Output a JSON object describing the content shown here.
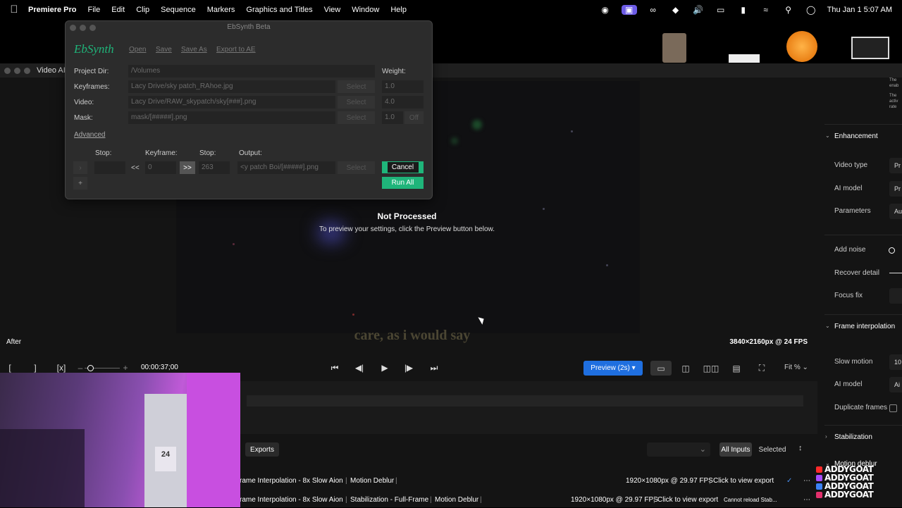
{
  "menubar": {
    "app": "Premiere Pro",
    "items": [
      "File",
      "Edit",
      "Clip",
      "Sequence",
      "Markers",
      "Graphics and Titles",
      "View",
      "Window",
      "Help"
    ],
    "clock": "Thu Jan 1  5:07 AM"
  },
  "video_window": {
    "title": "Video AI",
    "status_title": "Not Processed",
    "status_sub": "To preview your settings, click the Preview button below.",
    "caption": "care, as i would say",
    "after_label": "After",
    "resolution": "3840×2160px @ 24 FPS",
    "timecode": "00:00:37;00",
    "preview_button": "Preview (2s)",
    "fit_label": "Fit %"
  },
  "exports": {
    "tab": "Exports",
    "all_inputs": "All Inputs",
    "selected": "Selected",
    "rows": [
      {
        "name": "rame Interpolation - 8x Slow Aion",
        "tags": [
          "Motion Deblur"
        ],
        "spec": "1920×1080px @ 29.97 FPS",
        "link": "Click to view export",
        "extra": ""
      },
      {
        "name": "rame Interpolation - 8x Slow Aion",
        "tags": [
          "Stabilization - Full-Frame",
          "Motion Deblur"
        ],
        "spec": "1920×1080px @ 29.97 FPS",
        "link": "Click to view export",
        "extra": "Cannot reload Stab..."
      }
    ]
  },
  "right_panel": {
    "enhancement": "Enhancement",
    "video_type": "Video type",
    "video_type_val": "Pr",
    "ai_model": "AI model",
    "ai_model_val": "Pr",
    "parameters": "Parameters",
    "parameters_val": "Au",
    "add_noise": "Add noise",
    "recover_detail": "Recover detail",
    "focus_fix": "Focus fix",
    "frame_interp": "Frame interpolation",
    "slow_motion": "Slow motion",
    "slow_motion_val": "10",
    "ai_model_2": "AI model",
    "ai_model_2_val": "Ai",
    "duplicate_frames": "Duplicate frames",
    "stabilization": "Stabilization",
    "motion_deblur": "Motion deblur",
    "info_1": "The",
    "info_2": "enab",
    "info_3": "The",
    "info_4": "activ",
    "info_5": "rate"
  },
  "ebsynth": {
    "title": "EbSynth Beta",
    "logo": "EbSynth",
    "menu": [
      "Open",
      "Save",
      "Save As",
      "Export to AE"
    ],
    "project_dir_label": "Project Dir:",
    "project_dir": "/Volumes",
    "weight_label": "Weight:",
    "keyframes_label": "Keyframes:",
    "keyframes": "Lacy Drive/sky patch_RAhoe.jpg",
    "keyframes_weight": "1.0",
    "video_label": "Video:",
    "video": "Lacy Drive/RAW_skypatch/sky[###].png",
    "video_weight": "4.0",
    "mask_label": "Mask:",
    "mask": "mask/[#####].png",
    "mask_weight": "1.0",
    "mask_toggle": "Off",
    "select": "Select",
    "advanced": "Advanced",
    "stop_label": "Stop:",
    "keyframe_label": "Keyframe:",
    "stop2_label": "Stop:",
    "output_label": "Output:",
    "prev": "<<",
    "keyframe_val": "0",
    "next": ">>",
    "stop_val": "263",
    "output": "<y patch Boi/[#####].png",
    "cancel": "Cancel",
    "run_all": "Run All",
    "plus": "+"
  },
  "webcam": {
    "jersey": "24"
  },
  "watermark": {
    "lines": [
      "ADDYGOAT",
      "ADDYGOAT",
      "ADDYGOAT",
      "ADDYGOAT"
    ],
    "colors": [
      "#ff2a2a",
      "#a64dff",
      "#3b82f6",
      "#e1306c"
    ]
  }
}
